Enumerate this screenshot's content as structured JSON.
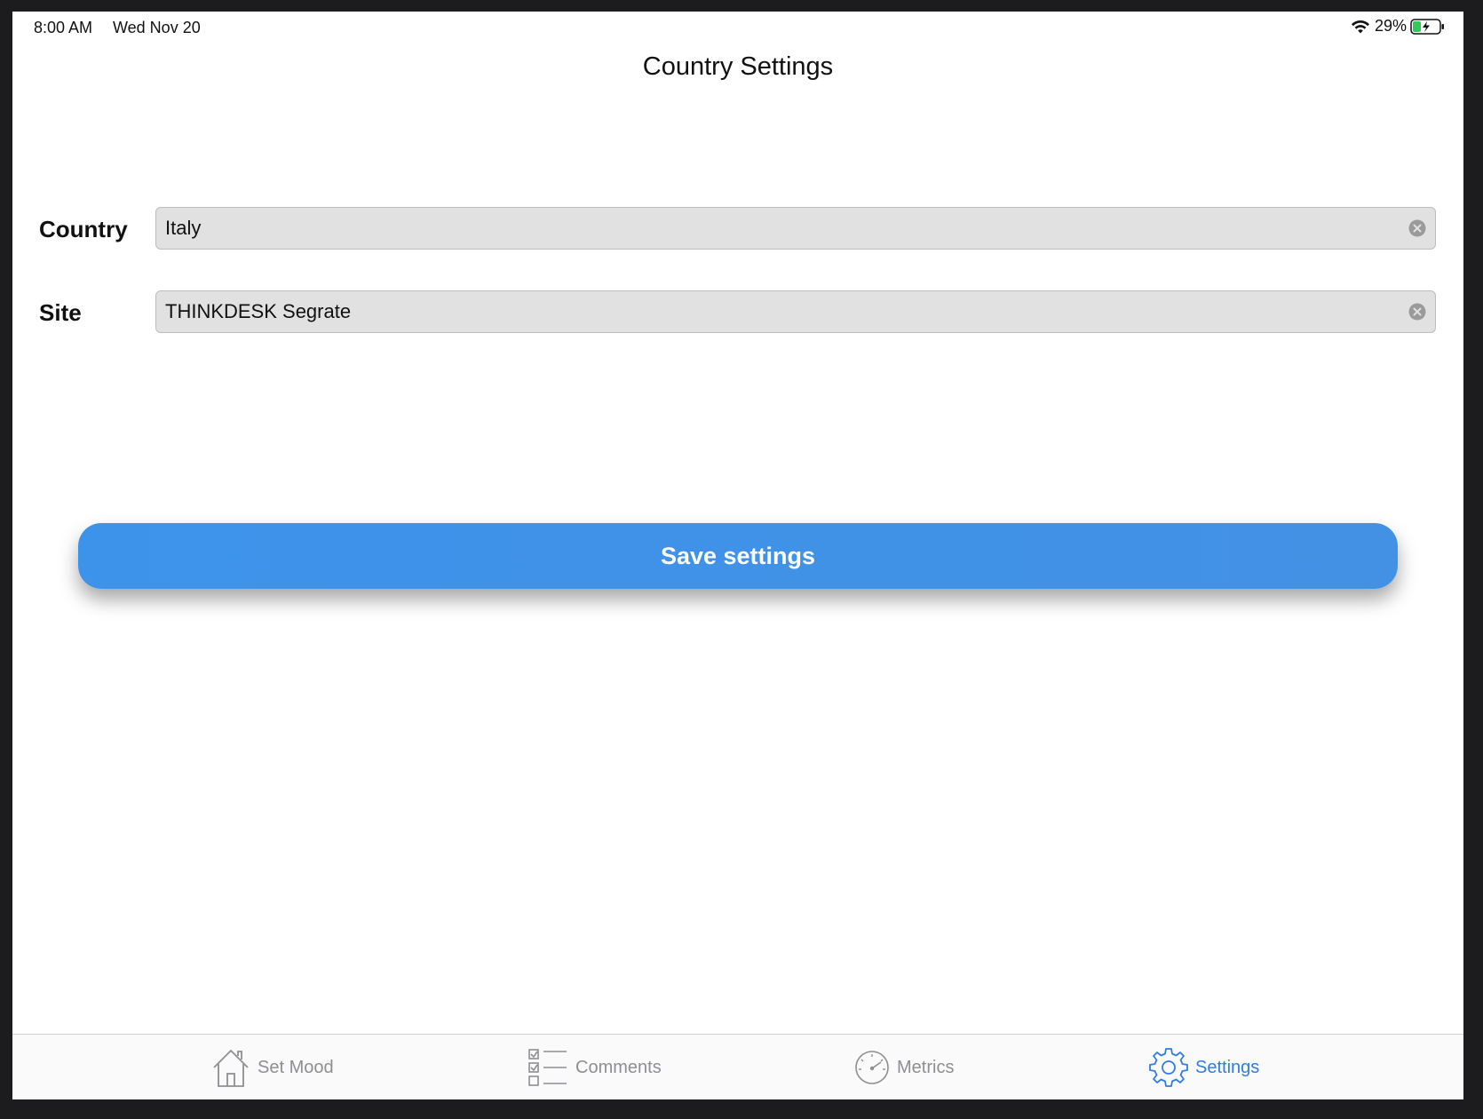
{
  "status_bar": {
    "time": "8:00 AM",
    "date": "Wed Nov 20",
    "battery": "29%",
    "icons": [
      "wifi-icon",
      "battery-charging-icon"
    ]
  },
  "header": {
    "title": "Country Settings"
  },
  "form": {
    "country": {
      "label": "Country",
      "value": "Italy"
    },
    "site": {
      "label": "Site",
      "value": "THINKDESK Segrate"
    }
  },
  "actions": {
    "save_label": "Save settings"
  },
  "tab_bar": {
    "items": [
      {
        "label": "Set Mood",
        "icon": "home-icon",
        "active": false
      },
      {
        "label": "Comments",
        "icon": "checklist-icon",
        "active": false
      },
      {
        "label": "Metrics",
        "icon": "gauge-icon",
        "active": false
      },
      {
        "label": "Settings",
        "icon": "gear-icon",
        "active": true
      }
    ]
  },
  "colors": {
    "accent": "#2f7de1",
    "button": "#3d93ea",
    "field_bg": "#e1e1e1",
    "inactive_tab": "#8e8e93"
  }
}
